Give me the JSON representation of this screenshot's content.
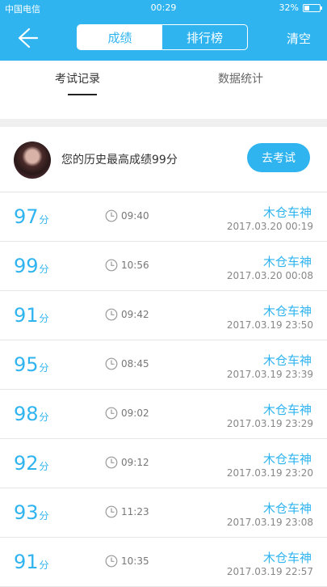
{
  "status_bar": {
    "carrier": "中国电信",
    "time": "00:29",
    "battery": "32%",
    "battery_level": 0.32
  },
  "nav": {
    "segments": [
      "成绩",
      "排行榜"
    ],
    "active_segment": 0,
    "clear_label": "清空"
  },
  "tabs": [
    "考试记录",
    "数据统计"
  ],
  "summary": {
    "text": "您的历史最高成绩99分",
    "button": "去考试"
  },
  "score_unit": "分",
  "records": [
    {
      "score": "97",
      "duration": "09:40",
      "name": "木仓车神",
      "date": "2017.03.20  00:19"
    },
    {
      "score": "99",
      "duration": "10:56",
      "name": "木仓车神",
      "date": "2017.03.20  00:08"
    },
    {
      "score": "91",
      "duration": "09:42",
      "name": "木仓车神",
      "date": "2017.03.19  23:50"
    },
    {
      "score": "95",
      "duration": "08:45",
      "name": "木仓车神",
      "date": "2017.03.19  23:39"
    },
    {
      "score": "98",
      "duration": "09:02",
      "name": "木仓车神",
      "date": "2017.03.19  23:29"
    },
    {
      "score": "92",
      "duration": "09:12",
      "name": "木仓车神",
      "date": "2017.03.19  23:20"
    },
    {
      "score": "93",
      "duration": "11:23",
      "name": "木仓车神",
      "date": "2017.03.19  23:08"
    },
    {
      "score": "91",
      "duration": "10:35",
      "name": "木仓车神",
      "date": "2017.03.19  22:57"
    }
  ],
  "colors": {
    "accent": "#2fb4f0"
  }
}
